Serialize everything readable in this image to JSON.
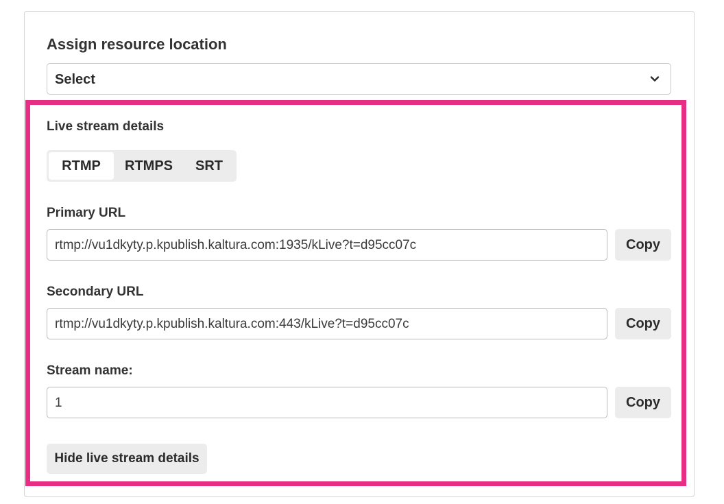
{
  "resource_location": {
    "title": "Assign resource location",
    "select_value": "Select",
    "chevron_icon": "chevron-down-icon"
  },
  "live_stream": {
    "title": "Live stream details",
    "protocols": [
      {
        "label": "RTMP",
        "active": true
      },
      {
        "label": "RTMPS",
        "active": false
      },
      {
        "label": "SRT",
        "active": false
      }
    ],
    "primary_url": {
      "label": "Primary URL",
      "value": "rtmp://vu1dkyty.p.kpublish.kaltura.com:1935/kLive?t=d95cc07c",
      "copy_label": "Copy"
    },
    "secondary_url": {
      "label": "Secondary URL",
      "value": "rtmp://vu1dkyty.p.kpublish.kaltura.com:443/kLive?t=d95cc07c",
      "copy_label": "Copy"
    },
    "stream_name": {
      "label": "Stream name:",
      "value": "1",
      "copy_label": "Copy"
    },
    "hide_label": "Hide live stream details"
  },
  "colors": {
    "highlight": "#e62e84",
    "button_bg": "#ececec"
  }
}
